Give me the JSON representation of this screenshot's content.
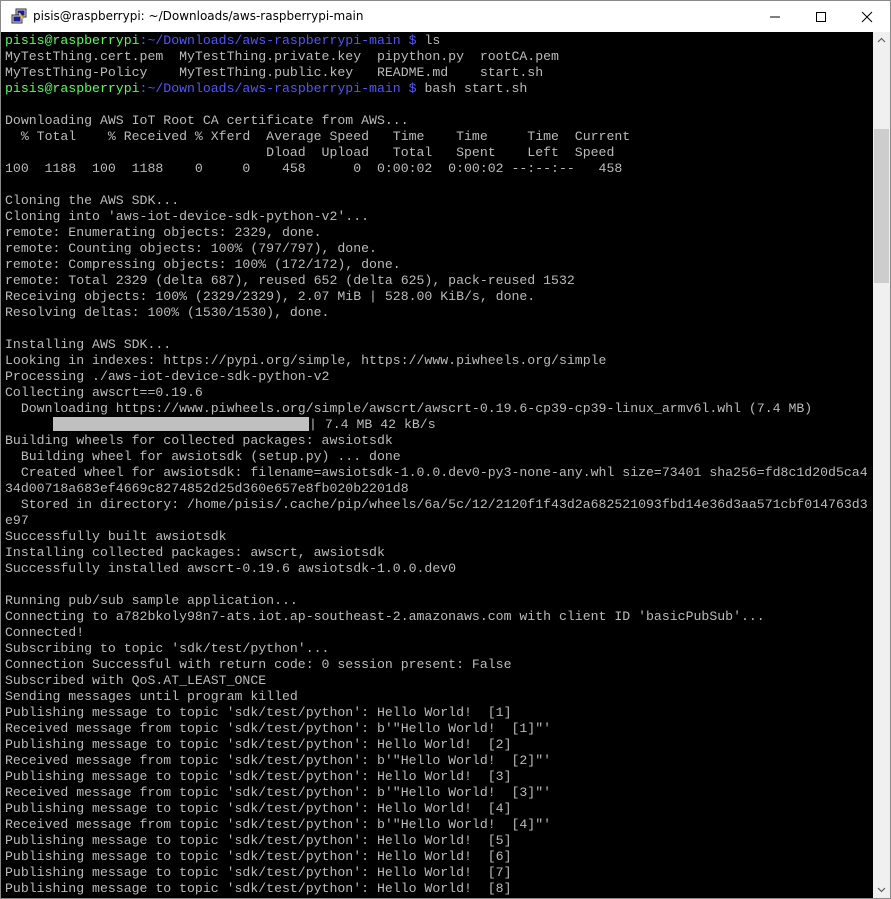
{
  "window": {
    "title": "pisis@raspberrypi: ~/Downloads/aws-raspberrypi-main",
    "minimize_icon": "minimize-icon",
    "maximize_icon": "maximize-icon",
    "close_icon": "close-icon",
    "app_icon": "putty-icon"
  },
  "colors": {
    "background": "#000000",
    "text": "#bbbbbb",
    "prompt_user": "#54ff54",
    "prompt_path": "#5454ff",
    "progress_bar": "#c0c0c0"
  },
  "prompt": {
    "user": "pisis@raspberrypi",
    "path": ":~/Downloads/aws-raspberrypi-main",
    "symbol": " $ ",
    "cmd1": "ls",
    "cmd2": "bash start.sh"
  },
  "download_progress": {
    "fraction": 1.0,
    "text": "| 7.4 MB 42 kB/s"
  },
  "lines": [
    "MyTestThing.cert.pem  MyTestThing.private.key  pipython.py  rootCA.pem",
    "MyTestThing-Policy    MyTestThing.public.key   README.md    start.sh",
    "",
    "Downloading AWS IoT Root CA certificate from AWS...",
    "  % Total    % Received % Xferd  Average Speed   Time    Time     Time  Current",
    "                                 Dload  Upload   Total   Spent    Left  Speed",
    "100  1188  100  1188    0     0    458      0  0:00:02  0:00:02 --:--:--   458",
    "",
    "Cloning the AWS SDK...",
    "Cloning into 'aws-iot-device-sdk-python-v2'...",
    "remote: Enumerating objects: 2329, done.",
    "remote: Counting objects: 100% (797/797), done.",
    "remote: Compressing objects: 100% (172/172), done.",
    "remote: Total 2329 (delta 687), reused 652 (delta 625), pack-reused 1532",
    "Receiving objects: 100% (2329/2329), 2.07 MiB | 528.00 KiB/s, done.",
    "Resolving deltas: 100% (1530/1530), done.",
    "",
    "Installing AWS SDK...",
    "Looking in indexes: https://pypi.org/simple, https://www.piwheels.org/simple",
    "Processing ./aws-iot-device-sdk-python-v2",
    "Collecting awscrt==0.19.6",
    "  Downloading https://www.piwheels.org/simple/awscrt/awscrt-0.19.6-cp39-cp39-linux_armv6l.whl (7.4 MB)",
    "Building wheels for collected packages: awsiotsdk",
    "  Building wheel for awsiotsdk (setup.py) ... done",
    "  Created wheel for awsiotsdk: filename=awsiotsdk-1.0.0.dev0-py3-none-any.whl size=73401 sha256=fd8c1d20d5ca4",
    "34d00718a683ef4669c8274852d25d360e657e8fb020b2201d8",
    "  Stored in directory: /home/pisis/.cache/pip/wheels/6a/5c/12/2120f1f43d2a682521093fbd14e36d3aa571cbf014763d3",
    "e97",
    "Successfully built awsiotsdk",
    "Installing collected packages: awscrt, awsiotsdk",
    "Successfully installed awscrt-0.19.6 awsiotsdk-1.0.0.dev0",
    "",
    "Running pub/sub sample application...",
    "Connecting to a782bkoly98n7-ats.iot.ap-southeast-2.amazonaws.com with client ID 'basicPubSub'...",
    "Connected!",
    "Subscribing to topic 'sdk/test/python'...",
    "Connection Successful with return code: 0 session present: False",
    "Subscribed with QoS.AT_LEAST_ONCE",
    "Sending messages until program killed",
    "Publishing message to topic 'sdk/test/python': Hello World!  [1]",
    "Received message from topic 'sdk/test/python': b'\"Hello World!  [1]\"'",
    "Publishing message to topic 'sdk/test/python': Hello World!  [2]",
    "Received message from topic 'sdk/test/python': b'\"Hello World!  [2]\"'",
    "Publishing message to topic 'sdk/test/python': Hello World!  [3]",
    "Received message from topic 'sdk/test/python': b'\"Hello World!  [3]\"'",
    "Publishing message to topic 'sdk/test/python': Hello World!  [4]",
    "Received message from topic 'sdk/test/python': b'\"Hello World!  [4]\"'",
    "Publishing message to topic 'sdk/test/python': Hello World!  [5]",
    "Publishing message to topic 'sdk/test/python': Hello World!  [6]",
    "Publishing message to topic 'sdk/test/python': Hello World!  [7]",
    "Publishing message to topic 'sdk/test/python': Hello World!  [8]"
  ]
}
